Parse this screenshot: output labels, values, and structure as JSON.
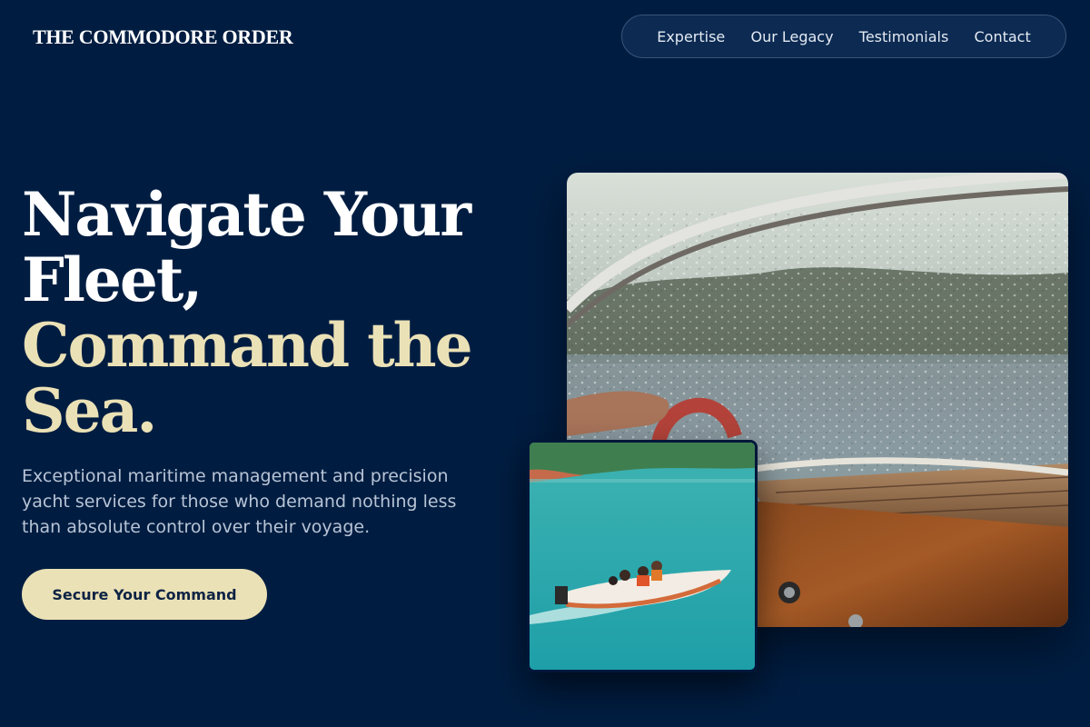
{
  "brand": {
    "name": "THE COMMODORE ORDER"
  },
  "nav": {
    "items": [
      "Expertise",
      "Our Legacy",
      "Testimonials",
      "Contact"
    ]
  },
  "hero": {
    "title_line1": "Navigate Your",
    "title_line2": "Fleet,",
    "title_line3": "Command the",
    "title_line4": "Sea.",
    "subtitle": "Exceptional maritime management and precision yacht services for those who demand nothing less than absolute control over their voyage.",
    "cta_label": "Secure Your Command"
  },
  "colors": {
    "background": "#001d41",
    "accent": "#ebe1b6",
    "nav_bg": "#0c2a52"
  },
  "images": {
    "main": "wooden-boat-windshield-photo",
    "secondary": "speedboat-on-turquoise-water-photo"
  }
}
